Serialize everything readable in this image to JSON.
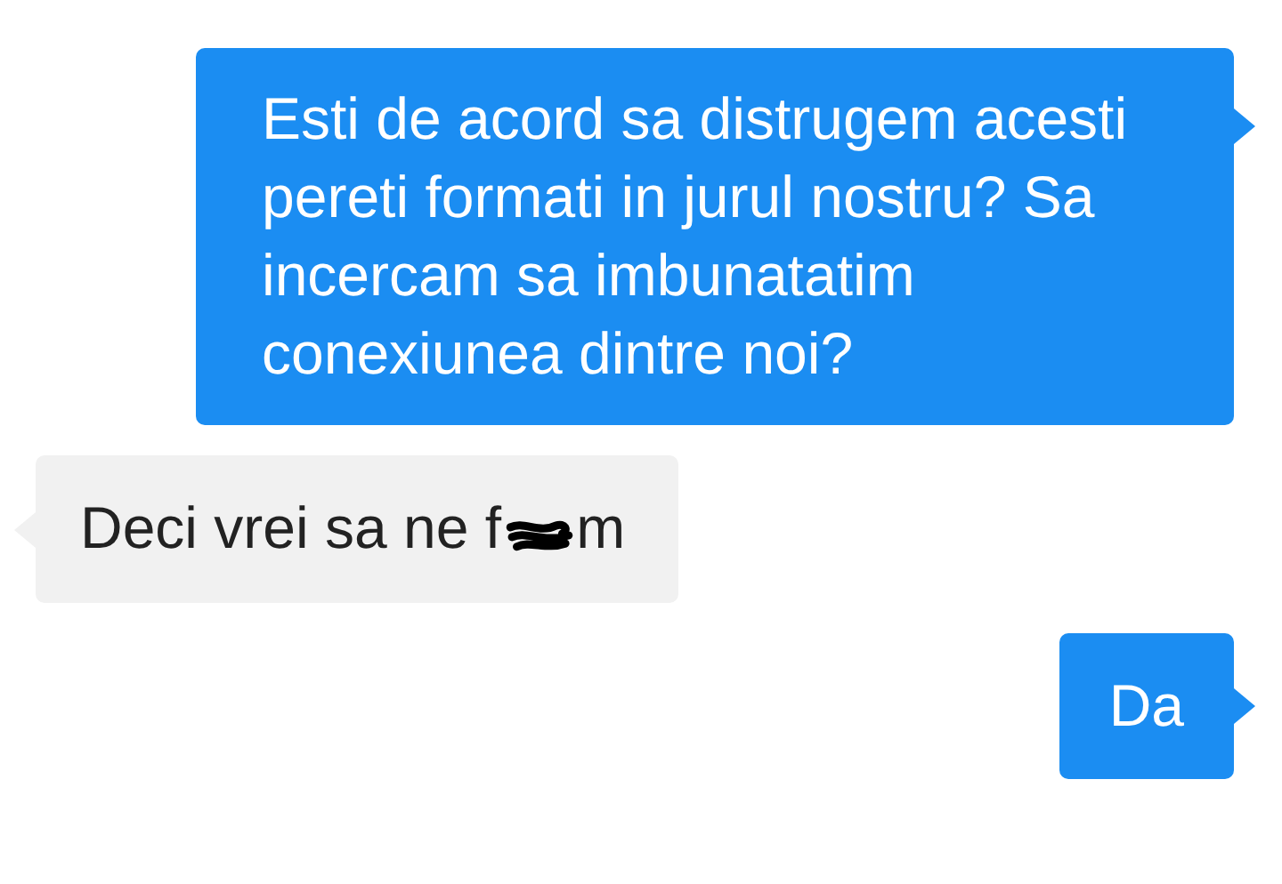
{
  "messages": [
    {
      "kind": "sent",
      "text": "Esti de acord sa distrugem acesti pereti formati in jurul nostru? Sa incercam sa imbunatatim conexiunea dintre noi?"
    },
    {
      "kind": "received",
      "text": "Deci vrei sa ne f",
      "censored": true,
      "text_after": "m"
    },
    {
      "kind": "sent",
      "text": "Da"
    }
  ]
}
